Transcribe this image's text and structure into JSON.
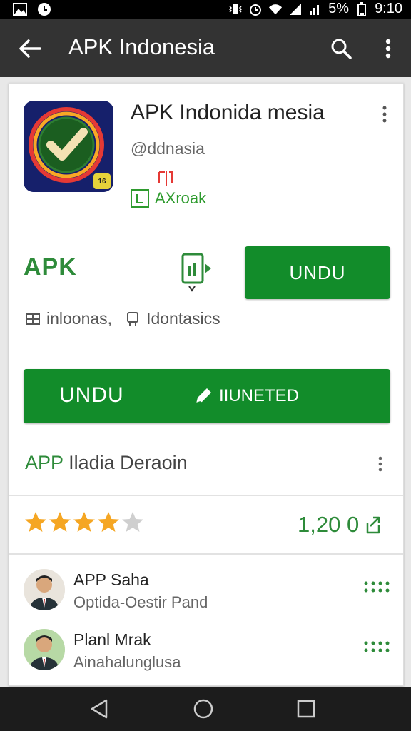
{
  "status_bar": {
    "battery": "5%",
    "time": "9:10"
  },
  "app_bar": {
    "title": "APK Indonesia"
  },
  "app": {
    "name": "APK Indonida mesia",
    "developer": "@ddnasia",
    "tag_label": "AXroak",
    "badge": "16"
  },
  "actions": {
    "apk_label": "APK",
    "undu_small": "UNDU",
    "meta_one": "inloonas,",
    "meta_two": "Idontasics",
    "big_left": "UNDU",
    "big_right": "IIUNETED"
  },
  "section": {
    "title_highlight": "APP",
    "title_rest": "Iladia Deraoin"
  },
  "rating": {
    "stars": 4,
    "max": 5,
    "count": "1,20 0"
  },
  "users": [
    {
      "name": "APP Saha",
      "subtitle": "Optida-Oestir Pand"
    },
    {
      "name": "Planl Mrak",
      "subtitle": "Ainahalunglusa"
    }
  ],
  "colors": {
    "accent_green": "#128c2a",
    "text_green": "#2e8b3a",
    "app_bar": "#333333",
    "star": "#f5a623"
  },
  "icons": {
    "back": "arrow-left-icon",
    "search": "search-icon",
    "more": "more-vert-icon",
    "install": "pencil-icon",
    "share": "share-icon",
    "nav_back": "triangle-back-icon",
    "nav_home": "circle-home-icon",
    "nav_recent": "square-recent-icon"
  }
}
